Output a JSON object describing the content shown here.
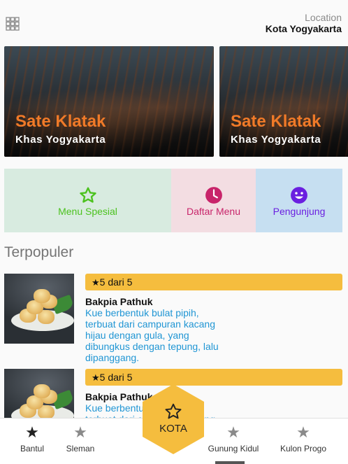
{
  "header": {
    "location_label": "Location",
    "location_value": "Kota Yogyakarta",
    "menu_icon": "grid-icon"
  },
  "banners": [
    {
      "title": "Sate Klatak",
      "subtitle": "Khas Yogyakarta"
    },
    {
      "title": "Sate Klatak",
      "subtitle": "Khas Yogyakarta"
    }
  ],
  "tiles": [
    {
      "label": "Menu Spesial",
      "icon": "star-outline-icon",
      "color": "#4cc21f",
      "bg": "#d8ebe0"
    },
    {
      "label": "Daftar Menu",
      "icon": "clock-icon",
      "color": "#c8246a",
      "bg": "#f3dde2"
    },
    {
      "label": "Pengunjung",
      "icon": "smiley-icon",
      "color": "#6a1fe0",
      "bg": "#c6dff1"
    }
  ],
  "section": {
    "title": "Terpopuler"
  },
  "foods": [
    {
      "rating": "5 dari 5",
      "name": "Bakpia Pathuk",
      "description": "Kue berbentuk bulat pipih, terbuat dari campuran kacang hijau dengan gula, yang dibungkus dengan tepung, lalu dipanggang."
    },
    {
      "rating": "5 dari 5",
      "name": "Bakpia Pathuk",
      "description": "Kue berbentuk bulat pipih, terbuat dari campuran kacang"
    }
  ],
  "bottom_nav": {
    "items": [
      {
        "label": "Bantul",
        "icon": "star-icon",
        "active": true
      },
      {
        "label": "Sleman",
        "icon": "star-icon",
        "active": false
      },
      {
        "label": "Gunung Kidul",
        "icon": "star-icon",
        "active": false
      },
      {
        "label": "Kulon Progo",
        "icon": "star-icon",
        "active": false
      }
    ],
    "center": {
      "label": "KOTA",
      "icon": "star-outline-icon"
    }
  },
  "colors": {
    "accent": "#f5bd3e",
    "banner_title": "#f07a28",
    "desc_text": "#2196d4"
  }
}
